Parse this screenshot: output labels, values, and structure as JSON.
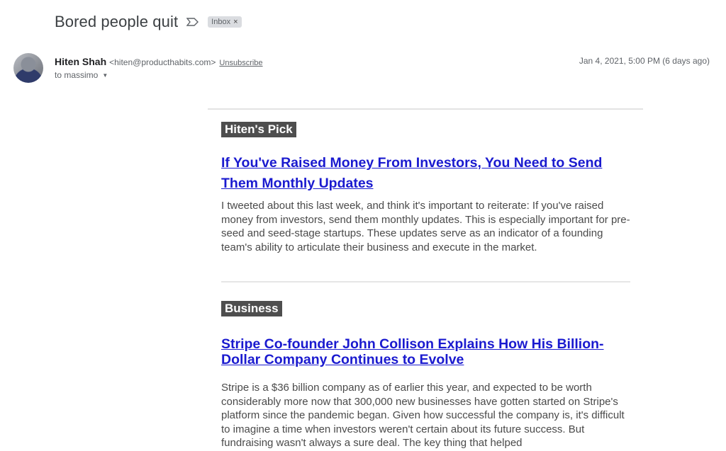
{
  "email": {
    "subject": "Bored people quit",
    "label": "Inbox",
    "label_remove": "×"
  },
  "sender": {
    "name": "Hiten Shah",
    "email": "<hiten@producthabits.com>",
    "unsubscribe": "Unsubscribe",
    "to": "to massimo",
    "date": "Jan 4, 2021, 5:00 PM (6 days ago)"
  },
  "icons": {
    "importance": "label-important-outline-icon",
    "to_caret": "caret-down-icon"
  },
  "sections": [
    {
      "tag": "Hiten's Pick",
      "title": "If You've Raised Money From Investors, You Need to Send Them Monthly Updates",
      "text": "I tweeted about this last week, and think it's important to reiterate: If you've raised money from investors, send them monthly updates. This is especially important for pre-seed and seed-stage startups. These updates serve as an indicator of a founding team's ability to articulate their business and execute in the market."
    },
    {
      "tag": "Business",
      "title": "Stripe Co-founder John Collison Explains How His Billion-Dollar Company Continues to Evolve",
      "text": "Stripe is a $36 billion company as of earlier this year, and expected to be worth considerably more now that 300,000 new businesses have gotten started on Stripe's platform since the pandemic began. Given how successful the company is, it's difficult to imagine a time when investors weren't certain about its future success. But fundraising wasn't always a sure deal. The key thing that helped"
    }
  ],
  "colors": {
    "link": "#1a1acf",
    "tag_bg": "#4e4e4e",
    "chip_bg": "#dadce0"
  }
}
